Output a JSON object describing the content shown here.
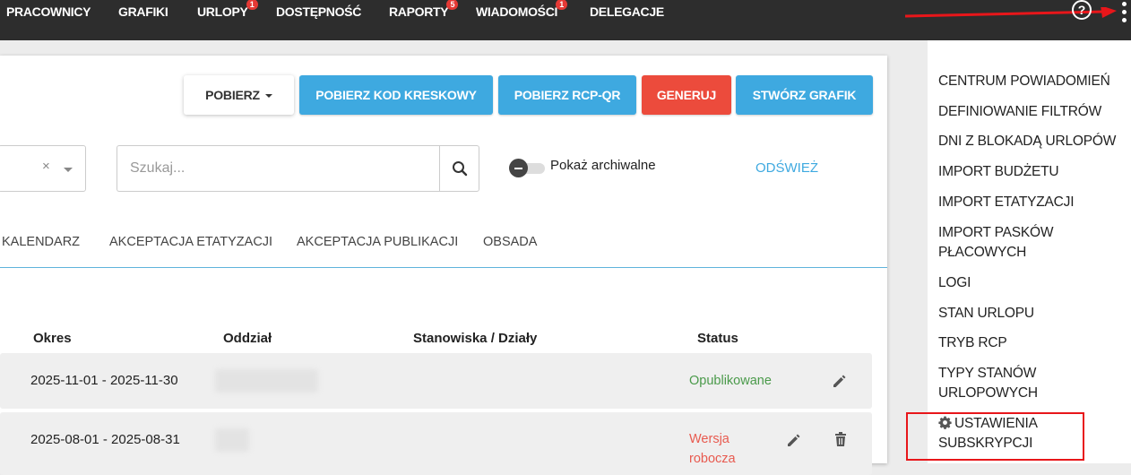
{
  "nav": {
    "items": [
      {
        "label": "PRACOWNICY",
        "badge": ""
      },
      {
        "label": "GRAFIKI",
        "badge": ""
      },
      {
        "label": "URLOPY",
        "badge": "1"
      },
      {
        "label": "DOSTĘPNOŚĆ",
        "badge": ""
      },
      {
        "label": "RAPORTY",
        "badge": "5"
      },
      {
        "label": "WIADOMOŚCI",
        "badge": "1"
      },
      {
        "label": "DELEGACJE",
        "badge": ""
      }
    ],
    "help_symbol": "?"
  },
  "toolbar": {
    "download_label": "POBIERZ",
    "barcode_label": "POBIERZ KOD KRESKOWY",
    "rcp_qr_label": "POBIERZ RCP-QR",
    "generate_label": "GENERUJ",
    "create_label": "STWÓRZ GRAFIK"
  },
  "filters": {
    "clear_symbol": "×",
    "search_placeholder": "Szukaj...",
    "archive_toggle_label": "Pokaż archiwalne",
    "refresh_label": "ODŚWIEŻ"
  },
  "tabs": [
    "KALENDARZ",
    "AKCEPTACJA ETATYZACJI",
    "AKCEPTACJA PUBLIKACJI",
    "OBSADA"
  ],
  "table": {
    "headers": [
      "Okres",
      "Oddział",
      "Stanowiska / Działy",
      "Status"
    ],
    "rows": [
      {
        "period": "2025-11-01 - 2025-11-30",
        "status": "Opublikowane"
      },
      {
        "period": "2025-08-01 - 2025-08-31",
        "status": "Wersja robocza"
      }
    ]
  },
  "menu": {
    "items": [
      "CENTRUM POWIADOMIEŃ",
      "DEFINIOWANIE FILTRÓW",
      "DNI Z BLOKADĄ URLOPÓW",
      "IMPORT BUDŻETU",
      "IMPORT ETATYZACJI",
      "IMPORT PASKÓW PŁACOWYCH",
      "LOGI",
      "STAN URLOPU",
      "TRYB RCP",
      "TYPY STANÓW URLOPOWYCH",
      "USTAWIENIA SUBSKRYPCJI"
    ]
  },
  "colors": {
    "nav_bg": "#2d2d2d",
    "primary": "#3ea9e0",
    "danger": "#ec4b3c",
    "status_published": "#4a9a4a",
    "status_draft": "#e85a4f",
    "highlight": "#e8161a"
  }
}
